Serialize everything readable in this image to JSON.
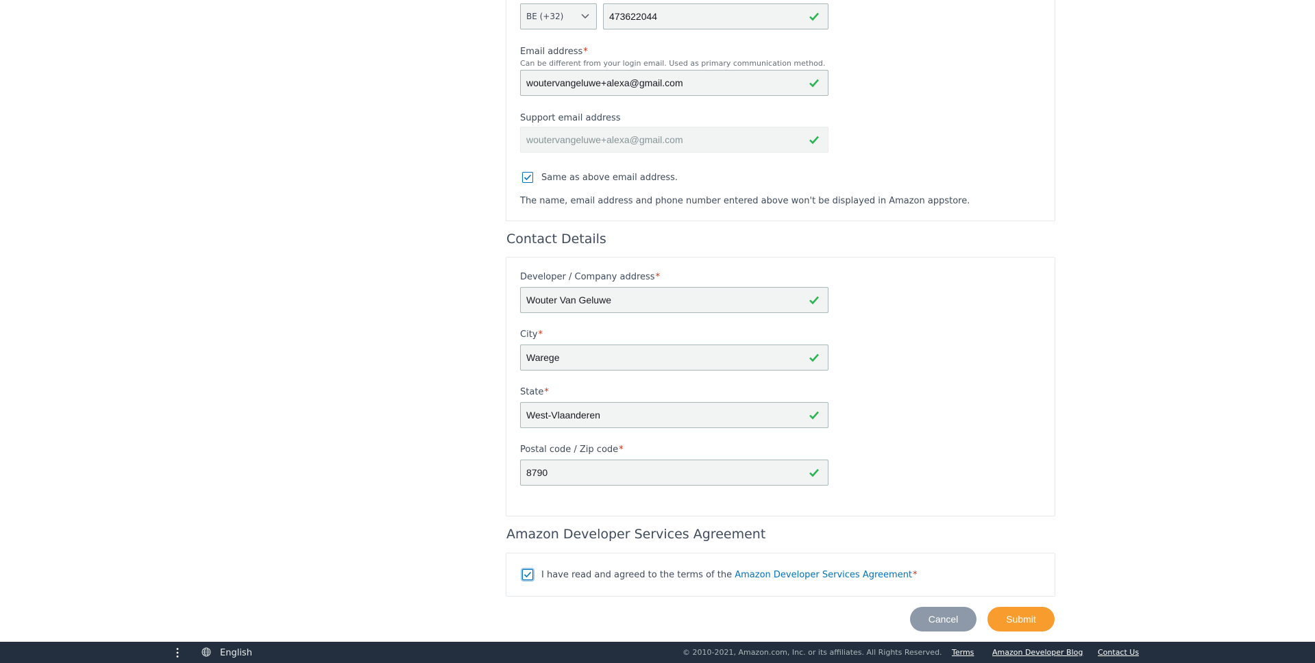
{
  "phone": {
    "country_code": "BE (+32)",
    "number": "473622044"
  },
  "email": {
    "label": "Email address",
    "hint": "Can be different from your login email. Used as primary communication method.",
    "value": "woutervangeluwe+alexa@gmail.com"
  },
  "support_email": {
    "label": "Support email address",
    "value": "woutervangeluwe+alexa@gmail.com"
  },
  "same_as_above": {
    "label": "Same as above email address.",
    "checked": true
  },
  "notice": "The name, email address and phone number entered above won't be displayed in Amazon appstore.",
  "contact_details": {
    "title": "Contact Details",
    "address": {
      "label": "Developer / Company address",
      "value": "Wouter Van Geluwe"
    },
    "city": {
      "label": "City",
      "value": "Warege"
    },
    "state": {
      "label": "State",
      "value": "West-Vlaanderen"
    },
    "postal": {
      "label": "Postal code / Zip code",
      "value": "8790"
    }
  },
  "agreement": {
    "title": "Amazon Developer Services Agreement",
    "text": "I have read and agreed to the terms of the ",
    "link": "Amazon Developer Services Agreement",
    "checked": true
  },
  "required_mark": "*",
  "buttons": {
    "cancel": "Cancel",
    "submit": "Submit"
  },
  "footer": {
    "language": "English",
    "copyright": "© 2010-2021, Amazon.com, Inc. or its affiliates. All Rights Reserved.",
    "links": [
      "Terms",
      "Amazon Developer Blog",
      "Contact Us"
    ]
  },
  "colors": {
    "valid_check": "#2bb550",
    "required": "#d13212",
    "link": "#0073bb",
    "submit": "#f79c2d",
    "cancel": "#8d99a8",
    "footer_bg": "#232f3e"
  }
}
